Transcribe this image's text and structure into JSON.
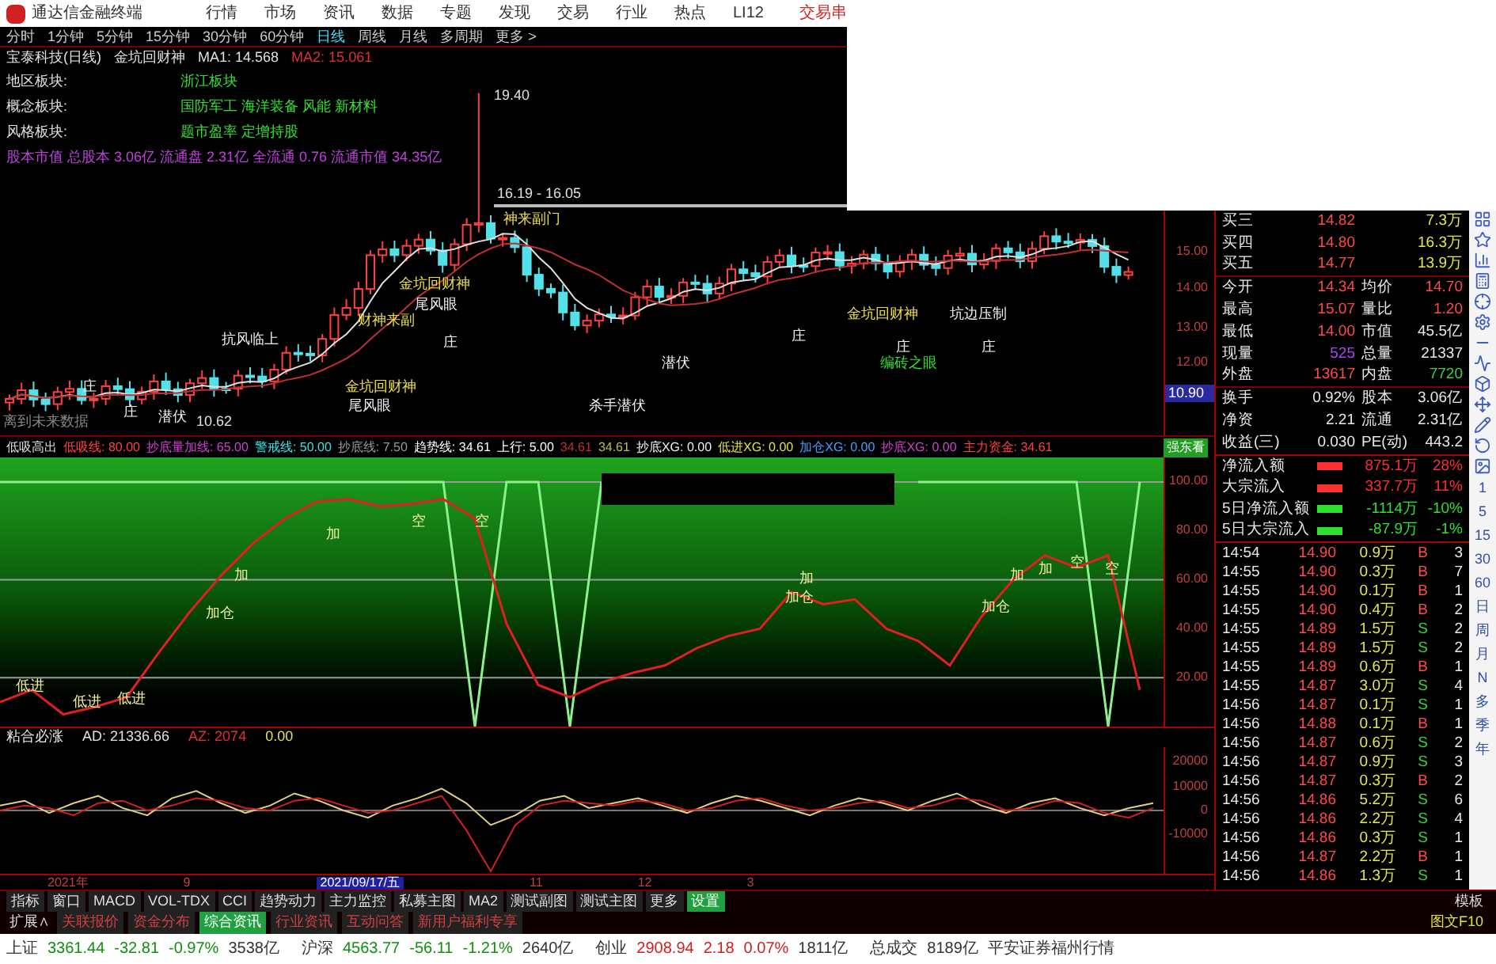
{
  "menu_bar": {
    "app_title": "通达信金融终端",
    "items": [
      "行情",
      "市场",
      "资讯",
      "数据",
      "专题",
      "发现",
      "交易",
      "行业",
      "热点",
      "LI12"
    ],
    "right_link": "交易串"
  },
  "period_bar": {
    "items": [
      {
        "label": "分时",
        "selected": false
      },
      {
        "label": "1分钟",
        "selected": false
      },
      {
        "label": "5分钟",
        "selected": false
      },
      {
        "label": "15分钟",
        "selected": false
      },
      {
        "label": "30分钟",
        "selected": false
      },
      {
        "label": "60分钟",
        "selected": false
      },
      {
        "label": "日线",
        "selected": true
      },
      {
        "label": "周线",
        "selected": false
      },
      {
        "label": "月线",
        "selected": false
      },
      {
        "label": "多周期",
        "selected": false
      },
      {
        "label": "更多 >",
        "selected": false
      }
    ]
  },
  "chart": {
    "title": "宝泰科技(日线)",
    "formula": "金坑回财神",
    "ma1": "MA1: 14.568",
    "ma2": "MA2: 15.061",
    "info_rows": [
      {
        "label": "地区板块:",
        "value": "浙江板块"
      },
      {
        "label": "概念板块:",
        "value": "国防军工 海洋装备 风能 新材料"
      },
      {
        "label": "风格板块:",
        "value": "题市盈率 定增持股"
      }
    ],
    "capital_line": "股本市值 总股本 3.06亿 流通盘 2.31亿 全流通 0.76 流通市值 34.35亿",
    "annotations": [
      {
        "text": "19.40",
        "kind": "price"
      },
      {
        "text": "16.19 - 16.05",
        "kind": "price"
      },
      {
        "text": "神来副门",
        "kind": "signal"
      },
      {
        "text": "金坑回财神",
        "kind": "signal"
      },
      {
        "text": "尾风眼",
        "kind": "plain"
      },
      {
        "text": "财神来副",
        "kind": "signal"
      },
      {
        "text": "抗风临上",
        "kind": "plain"
      },
      {
        "text": "金坑回财神",
        "kind": "signal"
      },
      {
        "text": "尾风眼",
        "kind": "plain"
      },
      {
        "text": "杀手潜伏",
        "kind": "plain"
      },
      {
        "text": "潜伏",
        "kind": "plain"
      },
      {
        "text": "潜伏",
        "kind": "plain"
      },
      {
        "text": "10.62",
        "kind": "price"
      },
      {
        "text": "庄",
        "kind": "plain"
      },
      {
        "text": "庄",
        "kind": "plain"
      },
      {
        "text": "庄",
        "kind": "plain"
      },
      {
        "text": "庄",
        "kind": "plain"
      },
      {
        "text": "金坑回财神",
        "kind": "signal"
      },
      {
        "text": "坑边压制",
        "kind": "plain"
      },
      {
        "text": "庄",
        "kind": "plain"
      },
      {
        "text": "庄",
        "kind": "plain"
      },
      {
        "text": "编砖之眼",
        "kind": "green"
      },
      {
        "text": "离到未来数据",
        "kind": "dim"
      }
    ],
    "axis": [
      "15.00",
      "14.00",
      "13.00",
      "12.00"
    ],
    "current_price": "10.90"
  },
  "indicator_1": {
    "items": [
      "低吸高出",
      "低吸线: 80.00",
      "抄底量加线: 65.00",
      "警戒线: 50.00",
      "抄底线: 7.50",
      "趋势线: 34.61",
      "上行: 5.00",
      "34.61",
      "34.61",
      "抄底XG: 0.00",
      "低进XG: 0.00",
      "加仓XG: 0.00",
      "抄底XG: 0.00",
      "主力资金: 34.61"
    ],
    "badge": "强东看",
    "labels": [
      "低进",
      "低进",
      "低进",
      "加仓",
      "加",
      "加",
      "空",
      "空",
      "加",
      "加仓",
      "加仓",
      "加",
      "加",
      "空",
      "空"
    ],
    "chart_data": {
      "type": "line",
      "ylim": [
        0,
        110
      ],
      "grid": true,
      "yticks": [
        {
          "value": 20,
          "label": "20.00"
        },
        {
          "value": 40,
          "label": "40.00"
        },
        {
          "value": 60,
          "label": "60.00"
        },
        {
          "value": 80,
          "label": "80.00"
        },
        {
          "value": 100,
          "label": "100.00"
        }
      ],
      "series": [
        {
          "color": "#8cf08c",
          "values": [
            100,
            100,
            100,
            100,
            100,
            100,
            100,
            100,
            100,
            100,
            100,
            100,
            100,
            100,
            100,
            0,
            100,
            100,
            0,
            100,
            null,
            null,
            null,
            null,
            null,
            null,
            null,
            null,
            null,
            100,
            100,
            100,
            100,
            100,
            100,
            0,
            100
          ]
        },
        {
          "color": "#e02020",
          "values": [
            10,
            15,
            5,
            8,
            12,
            30,
            47,
            62,
            75,
            85,
            92,
            93,
            90,
            91,
            93,
            85,
            42,
            17,
            12,
            18,
            22,
            25,
            32,
            37,
            40,
            55,
            50,
            52,
            40,
            35,
            25,
            45,
            60,
            70,
            65,
            70,
            15
          ]
        }
      ]
    }
  },
  "indicator_2": {
    "title": "粘合必涨",
    "ad": "AD: 21336.66",
    "az": "AZ: 2074",
    "value": "0.00",
    "chart_data": {
      "type": "line",
      "ylim": [
        -26000,
        26000
      ],
      "yticks": [
        -10000,
        0,
        10000,
        20000
      ],
      "series": [
        {
          "color": "#e0d080",
          "values": [
            2000,
            4000,
            -1000,
            3000,
            6000,
            1000,
            -2000,
            5000,
            8000,
            3000,
            -1000,
            2000,
            7000,
            4000,
            0,
            -3000,
            2000,
            5000,
            9000,
            3000,
            -6000,
            -2000,
            4000,
            6000,
            1000,
            3000,
            5000,
            2000,
            -1000,
            3000,
            6000,
            4000,
            1000,
            -2000,
            2000,
            5000,
            3000,
            0,
            4000,
            7000,
            2000,
            -1000,
            3000,
            5000,
            1000,
            -2000,
            1000,
            3000
          ]
        },
        {
          "color": "#d02020",
          "values": [
            0,
            2000,
            1000,
            -2000,
            3000,
            4000,
            0,
            2000,
            5000,
            4000,
            1000,
            0,
            4000,
            5000,
            2000,
            -1000,
            0,
            3000,
            6000,
            -8000,
            -25000,
            -6000,
            2000,
            4000,
            3000,
            2000,
            4000,
            3000,
            0,
            1000,
            4000,
            5000,
            2000,
            0,
            1000,
            3000,
            4000,
            1000,
            2000,
            5000,
            4000,
            0,
            1000,
            4000,
            3000,
            -1000,
            -3000,
            1000
          ]
        }
      ]
    }
  },
  "date_axis": [
    {
      "text": "2021年",
      "kind": "plain"
    },
    {
      "text": "9",
      "kind": "plain"
    },
    {
      "text": "2021/09/17/五",
      "kind": "cursor"
    },
    {
      "text": "11",
      "kind": "plain"
    },
    {
      "text": "12",
      "kind": "plain"
    },
    {
      "text": "3",
      "kind": "plain"
    }
  ],
  "quotes": [
    {
      "cells": [
        {
          "label": "买三",
          "value": "14.82",
          "color": "#ff4a4a"
        },
        {
          "value": "7.3万",
          "color": "#e6e64a"
        }
      ]
    },
    {
      "cells": [
        {
          "label": "买四",
          "value": "14.80",
          "color": "#ff4a4a"
        },
        {
          "value": "16.3万",
          "color": "#e6e64a"
        }
      ]
    },
    {
      "cells": [
        {
          "label": "买五",
          "value": "14.77",
          "color": "#ff4a4a"
        },
        {
          "value": "13.9万",
          "color": "#e6e64a"
        }
      ]
    },
    {
      "cells": [
        {
          "label": "今开",
          "value": "14.34",
          "color": "#ff4a4a"
        },
        {
          "label": "均价",
          "value": "14.70",
          "color": "#ff4a4a"
        }
      ]
    },
    {
      "cells": [
        {
          "label": "最高",
          "value": "15.07",
          "color": "#ff4a4a"
        },
        {
          "label": "量比",
          "value": "1.20",
          "color": "#ff4a4a"
        }
      ]
    },
    {
      "cells": [
        {
          "label": "最低",
          "value": "14.00",
          "color": "#ff4a4a"
        },
        {
          "label": "市值",
          "value": "45.5亿",
          "color": "#e8e8e8"
        }
      ]
    },
    {
      "cells": [
        {
          "label": "现量",
          "value": "525",
          "color": "#b040ff"
        },
        {
          "label": "总量",
          "value": "21337",
          "color": "#e8e8e8"
        }
      ]
    },
    {
      "cells": [
        {
          "label": "外盘",
          "value": "13617",
          "color": "#ff4a4a"
        },
        {
          "label": "内盘",
          "value": "7720",
          "color": "#3cd23c"
        }
      ]
    },
    {
      "cells": [
        {
          "label": "换手",
          "value": "0.92%",
          "color": "#e8e8e8"
        },
        {
          "label": "股本",
          "value": "3.06亿",
          "color": "#e8e8e8"
        }
      ]
    },
    {
      "cells": [
        {
          "label": "净资",
          "value": "2.21",
          "color": "#e8e8e8"
        },
        {
          "label": "流通",
          "value": "2.31亿",
          "color": "#e8e8e8"
        }
      ]
    },
    {
      "cells": [
        {
          "label": "收益(三)",
          "value": "0.030",
          "color": "#e8e8e8"
        },
        {
          "label": "PE(动)",
          "value": "443.2",
          "color": "#e8e8e8"
        }
      ]
    }
  ],
  "flows": [
    {
      "label": "净流入额",
      "color": "#ff3030",
      "value": "875.1万",
      "pct": "28%"
    },
    {
      "label": "大宗流入",
      "color": "#ff3030",
      "value": "337.7万",
      "pct": "11%"
    },
    {
      "label": "5日净流入额",
      "color": "#30e030",
      "value": "-1114万",
      "pct": "-10%"
    },
    {
      "label": "5日大宗流入",
      "color": "#30e030",
      "value": "-87.9万",
      "pct": "-1%"
    }
  ],
  "ticks": [
    {
      "time": "14:54",
      "price": "14.90",
      "volume": "0.9万",
      "side": "B",
      "color": "#ff4a4a",
      "count": "3"
    },
    {
      "time": "14:55",
      "price": "14.90",
      "volume": "0.3万",
      "side": "B",
      "color": "#ff4a4a",
      "count": "7"
    },
    {
      "time": "14:55",
      "price": "14.90",
      "volume": "0.1万",
      "side": "B",
      "color": "#ff4a4a",
      "count": "1"
    },
    {
      "time": "14:55",
      "price": "14.90",
      "volume": "0.4万",
      "side": "B",
      "color": "#ff4a4a",
      "count": "2"
    },
    {
      "time": "14:55",
      "price": "14.89",
      "volume": "1.5万",
      "side": "S",
      "color": "#3cd23c",
      "count": "2"
    },
    {
      "time": "14:55",
      "price": "14.89",
      "volume": "1.5万",
      "side": "S",
      "color": "#3cd23c",
      "count": "2"
    },
    {
      "time": "14:55",
      "price": "14.89",
      "volume": "0.6万",
      "side": "B",
      "color": "#ff4a4a",
      "count": "1"
    },
    {
      "time": "14:55",
      "price": "14.87",
      "volume": "3.0万",
      "side": "S",
      "color": "#3cd23c",
      "count": "4"
    },
    {
      "time": "14:56",
      "price": "14.87",
      "volume": "0.1万",
      "side": "S",
      "color": "#3cd23c",
      "count": "1"
    },
    {
      "time": "14:56",
      "price": "14.88",
      "volume": "0.1万",
      "side": "B",
      "color": "#ff4a4a",
      "count": "1"
    },
    {
      "time": "14:56",
      "price": "14.87",
      "volume": "0.6万",
      "side": "S",
      "color": "#3cd23c",
      "count": "2"
    },
    {
      "time": "14:56",
      "price": "14.87",
      "volume": "0.9万",
      "side": "S",
      "color": "#3cd23c",
      "count": "3"
    },
    {
      "time": "14:56",
      "price": "14.87",
      "volume": "0.3万",
      "side": "B",
      "color": "#ff4a4a",
      "count": "2"
    },
    {
      "time": "14:56",
      "price": "14.86",
      "volume": "5.2万",
      "side": "S",
      "color": "#3cd23c",
      "count": "6"
    },
    {
      "time": "14:56",
      "price": "14.86",
      "volume": "2.2万",
      "side": "S",
      "color": "#3cd23c",
      "count": "4"
    },
    {
      "time": "14:56",
      "price": "14.86",
      "volume": "0.3万",
      "side": "S",
      "color": "#3cd23c",
      "count": "1"
    },
    {
      "time": "14:56",
      "price": "14.87",
      "volume": "2.2万",
      "side": "B",
      "color": "#ff4a4a",
      "count": "1"
    },
    {
      "time": "14:56",
      "price": "14.86",
      "volume": "1.3万",
      "side": "S",
      "color": "#3cd23c",
      "count": "1"
    }
  ],
  "side_toolbar": [
    "1",
    "5",
    "15",
    "30",
    "60",
    "日",
    "周",
    "月",
    "N",
    "多",
    "季",
    "年"
  ],
  "bottom_tabs": {
    "items": [
      {
        "label": "指标",
        "selected": false
      },
      {
        "label": "窗口",
        "selected": false
      },
      {
        "label": "MACD",
        "selected": false
      },
      {
        "label": "VOL-TDX",
        "selected": false
      },
      {
        "label": "CCI",
        "selected": false
      },
      {
        "label": "趋势动力",
        "selected": false
      },
      {
        "label": "主力监控",
        "selected": false
      },
      {
        "label": "私募主图",
        "selected": false
      },
      {
        "label": "MA2",
        "selected": false
      },
      {
        "label": "测试副图",
        "selected": false
      },
      {
        "label": "测试主图",
        "selected": false
      },
      {
        "label": "更多",
        "selected": false
      },
      {
        "label": "设置",
        "selected": true
      }
    ],
    "right": "模板"
  },
  "extension_bar": {
    "toggle": "扩展∧",
    "items": [
      {
        "label": "关联报价",
        "selected": false
      },
      {
        "label": "资金分布",
        "selected": false
      },
      {
        "label": "综合资讯",
        "selected": true
      },
      {
        "label": "行业资讯",
        "selected": false
      },
      {
        "label": "互动问答",
        "selected": false
      },
      {
        "label": "新用户福利专享",
        "selected": false
      }
    ],
    "right": "图文F10"
  },
  "status_bar": {
    "indices": [
      {
        "name": "上证",
        "value": "3361.44",
        "change": "-32.81",
        "pct": "-0.97%",
        "amount": "3538亿",
        "color": "#109010"
      },
      {
        "name": "沪深",
        "value": "4563.77",
        "change": "-56.11",
        "pct": "-1.21%",
        "amount": "2640亿",
        "color": "#109010"
      },
      {
        "name": "创业",
        "value": "2908.94",
        "change": "2.18",
        "pct": "0.07%",
        "amount": "1811亿",
        "color": "#d02020"
      }
    ],
    "total_label": "总成交",
    "total": "8189亿",
    "broker": "平安证券福州行情"
  }
}
